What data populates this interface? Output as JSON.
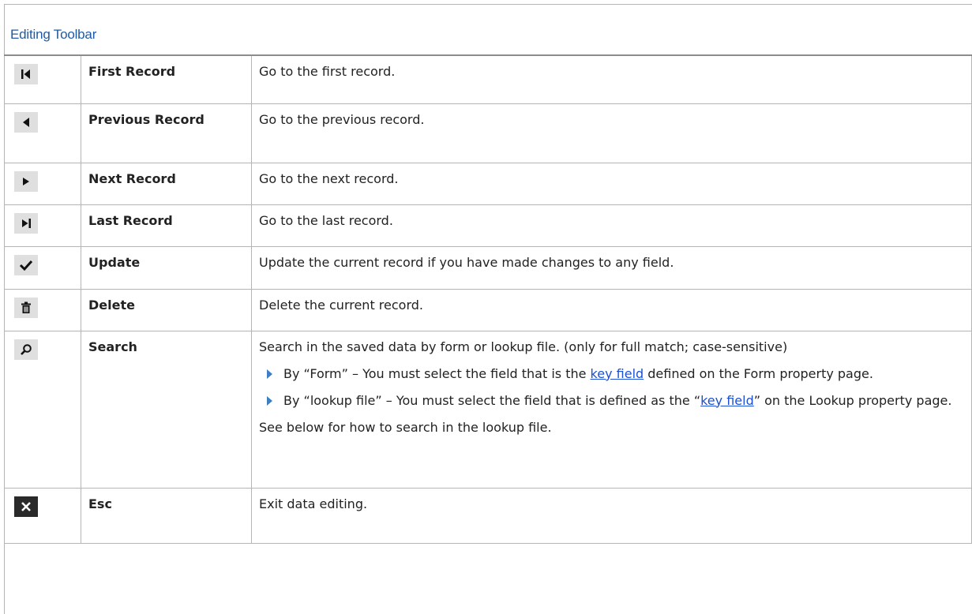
{
  "section_title": "Editing Toolbar",
  "rows": [
    {
      "icon": "first-record-icon",
      "name": "First Record",
      "desc": "Go to the first record."
    },
    {
      "icon": "previous-record-icon",
      "name": "Previous Record",
      "desc": "Go to the previous record."
    },
    {
      "icon": "next-record-icon",
      "name": "Next Record",
      "desc": "Go to the next record."
    },
    {
      "icon": "last-record-icon",
      "name": "Last Record",
      "desc": "Go to the last record."
    },
    {
      "icon": "checkmark-icon",
      "name": "Update",
      "desc": "Update the current record if you have made changes to any field."
    },
    {
      "icon": "trash-icon",
      "name": "Delete",
      "desc": "Delete the current record."
    },
    {
      "icon": "magnifier-icon",
      "name": "Search",
      "desc": "Search in the saved data by form or lookup file. (only for full match; case-sensitive)",
      "bullets": [
        {
          "before": "By “Form” – You must select the field that is the ",
          "link": "key field",
          "after": " defined on the Form property page."
        },
        {
          "before": "By “lookup file” – You must select the field that is defined as the “",
          "link": "key field",
          "after": "” on the Lookup property page."
        }
      ],
      "note": "See below for how to search in the lookup file."
    },
    {
      "icon": "close-icon",
      "name": "Esc",
      "desc": "Exit data editing."
    }
  ]
}
